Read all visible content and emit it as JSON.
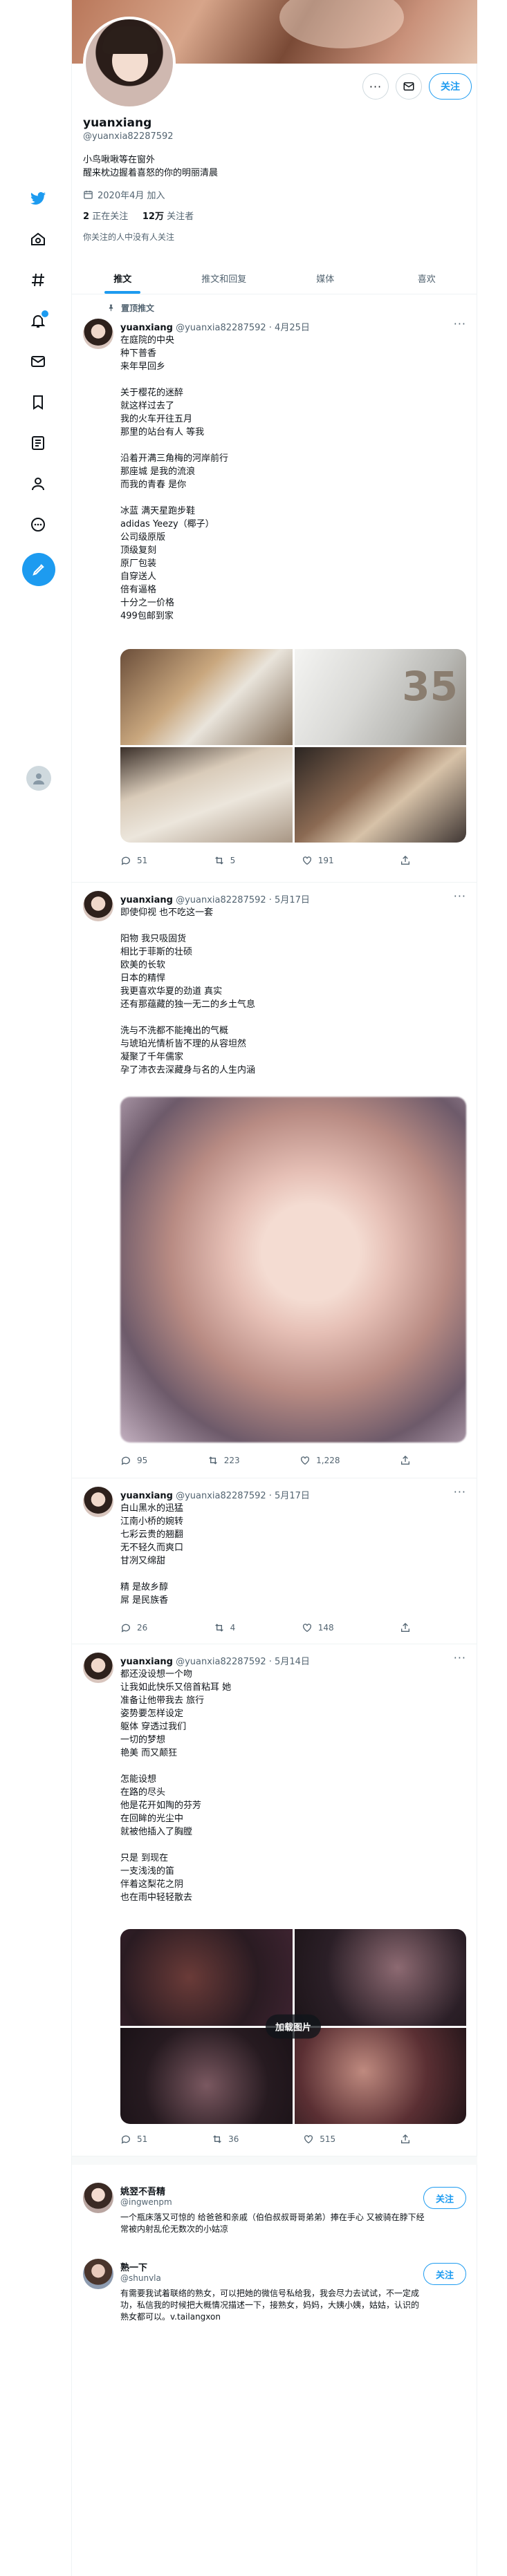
{
  "profile": {
    "name": "yuanxiang",
    "handle": "@yuanxia82287592",
    "bio_line1": "小鸟啾啾等在窗外",
    "bio_line2": "醒来枕边握着喜怒的你的明丽清晨",
    "joined": "2020年4月 加入",
    "following_count": "2",
    "following_label": "正在关注",
    "followers_count": "12万",
    "followers_label": "关注者",
    "known_followers": "你关注的人中没有人关注",
    "follow_label": "关注"
  },
  "tabs": [
    "推文",
    "推文和回复",
    "媒体",
    "喜欢"
  ],
  "pinned_label": "置顶推文",
  "tweets": [
    {
      "name": "yuanxiang",
      "handle": "@yuanxia82287592 · 4月25日",
      "text": "在庭院的中央\n种下普香\n来年早回乡\n\n关于樱花的迷醉\n就这样过去了\n我的火车开往五月\n那里的站台有人 等我\n\n沿着开满三角梅的河岸前行\n那座城 是我的流浪\n而我的青春 是你\n\n冰蓝 满天星跑步鞋\nadidas Yeezy（椰子）\n公司级原版\n顶级复刻\n原厂包装\n自穿送人\n倍有逼格\n十分之一价格\n499包邮到家",
      "reply": "51",
      "retweet": "5",
      "like": "191"
    },
    {
      "name": "yuanxiang",
      "handle": "@yuanxia82287592 · 5月17日",
      "text": "即使仰视 也不吃这一套\n\n阳物 我只吸固货\n相比于菲斯的壮硕\n欧美的长软\n日本的精悍\n我更喜欢华夏的劲道 真实\n还有那蕴藏的独一无二的乡土气息\n\n洗与不洗都不能掩出的气概\n与琥珀光情析皆不理的从容坦然\n凝聚了千年儒家\n孕了沛衣去深藏身与名的人生内涵",
      "reply": "95",
      "retweet": "223",
      "like": "1,228"
    },
    {
      "name": "yuanxiang",
      "handle": "@yuanxia82287592 · 5月17日",
      "text": "白山黑水的迅猛\n江南小桥的婉转\n七彩云贵的翘翻\n无不轻久而爽口\n甘冽又绵甜\n\n精 是故乡醇\n屌 是民族香",
      "reply": "26",
      "retweet": "4",
      "like": "148"
    },
    {
      "name": "yuanxiang",
      "handle": "@yuanxia82287592 · 5月14日",
      "text": "都还没设想一个吻\n让我如此快乐又倍首粘耳 她\n准备让他带我去 旅行\n姿势要怎样设定\n躯体 穿透过我们\n一切的梦想\n艳美 而又颠狂\n\n怎能设想\n在路的尽头\n他是花开如陶的芬芳\n在回眸的光尘中\n就被他插入了胸膛\n\n只是 到现在\n一支浅浅的笛\n伴着这梨花之阴\n也在雨中轻轻散去",
      "load_more": "加载图片",
      "reply": "51",
      "retweet": "36",
      "like": "515"
    }
  ],
  "recommendations": [
    {
      "name": "姚翌不吾精",
      "handle": "@ingwenpm",
      "bio": "一个瓶床落又可惊的 给爸爸和亲戚（伯伯叔叔哥哥弟弟）捧在手心 又被骑在脖下经常被内射乱伦无数次的小姑凉",
      "follow": "关注"
    },
    {
      "name": "熟一下",
      "handle": "@shunvla",
      "bio": "有需要我试着联络的熟女，可以把她的微信号私给我，我会尽力去试试，不一定成功，私信我的时候把大概情况描述一下，接熟女，妈妈，大姨小姨，姑姑，认识的熟女都可以。v.tailangxon",
      "follow": "关注"
    }
  ],
  "colors": {
    "accent": "#1d9bf0",
    "text": "#0f1419",
    "muted": "#536471",
    "border": "#eff3f4"
  }
}
